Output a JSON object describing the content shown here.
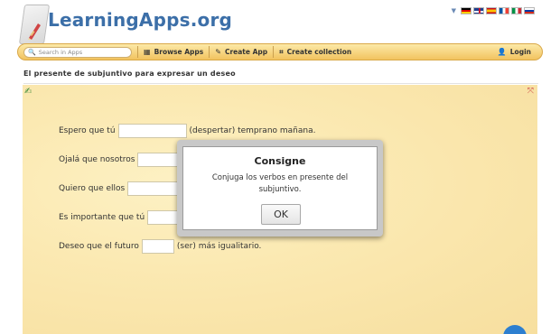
{
  "header": {
    "logo_text": "LearningApps.org",
    "flags": [
      "de",
      "gb",
      "es",
      "fr",
      "it",
      "ru"
    ]
  },
  "navbar": {
    "search_placeholder": "Search in Apps",
    "browse_label": "Browse Apps",
    "create_label": "Create App",
    "collection_label": "Create collection",
    "login_label": "Login"
  },
  "page": {
    "title": "El presente de subjuntivo para expresar un deseo"
  },
  "exercise": {
    "sentences": [
      {
        "before": "Espero que tú",
        "after": "(despertar) temprano mañana."
      },
      {
        "before": "Ojalá que nosotros",
        "after": ""
      },
      {
        "before": "Quiero que ellos",
        "after": ""
      },
      {
        "before": "Es importante que tú",
        "after": ""
      },
      {
        "before": "Deseo que el futuro",
        "after": "(ser) más igualitario."
      }
    ]
  },
  "dialog": {
    "title": "Consigne",
    "text": "Conjuga los verbos en presente del subjuntivo.",
    "ok_label": "OK"
  },
  "colors": {
    "logo_blue": "#3c6fa8",
    "nav_yellow": "#f2c35f",
    "paper": "#fbe9b2"
  }
}
